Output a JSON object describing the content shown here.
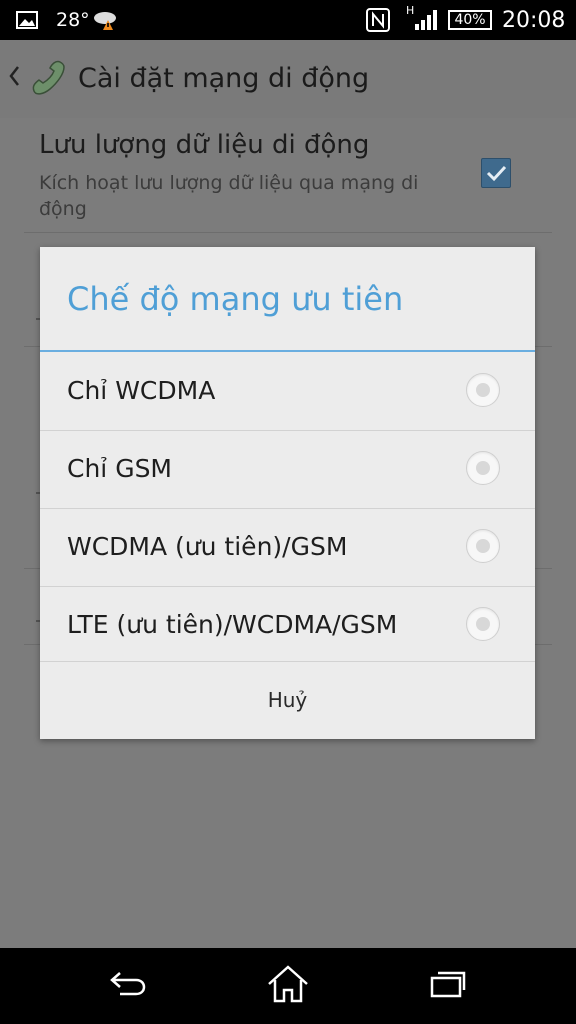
{
  "status_bar": {
    "temperature": "28°",
    "network_type": "H",
    "battery": "40%",
    "time": "20:08",
    "icons": [
      "gallery-icon",
      "weather-alert-icon",
      "nfc-icon",
      "signal-icon",
      "battery-icon"
    ]
  },
  "action_bar": {
    "back_icon": "chevron-left-icon",
    "app_icon": "phone-handset-icon",
    "title": "Cài đặt mạng di động"
  },
  "settings": {
    "mobile_data": {
      "title": "Lưu lượng dữ liệu di động",
      "summary": "Kích hoạt lưu lượng dữ liệu qua mạng di động",
      "checked": true
    }
  },
  "dialog": {
    "title": "Chế độ mạng ưu tiên",
    "options": [
      {
        "label": "Chỉ WCDMA",
        "selected": false
      },
      {
        "label": "Chỉ GSM",
        "selected": false
      },
      {
        "label": "WCDMA (ưu tiên)/GSM",
        "selected": false
      },
      {
        "label": "LTE (ưu tiên)/WCDMA/GSM",
        "selected": false
      }
    ],
    "cancel_label": "Huỷ"
  },
  "nav_bar": {
    "icons": [
      "back-icon",
      "home-icon",
      "recents-icon"
    ]
  },
  "colors": {
    "accent": "#4f9fd6",
    "checkbox": "#3f6a8d"
  }
}
